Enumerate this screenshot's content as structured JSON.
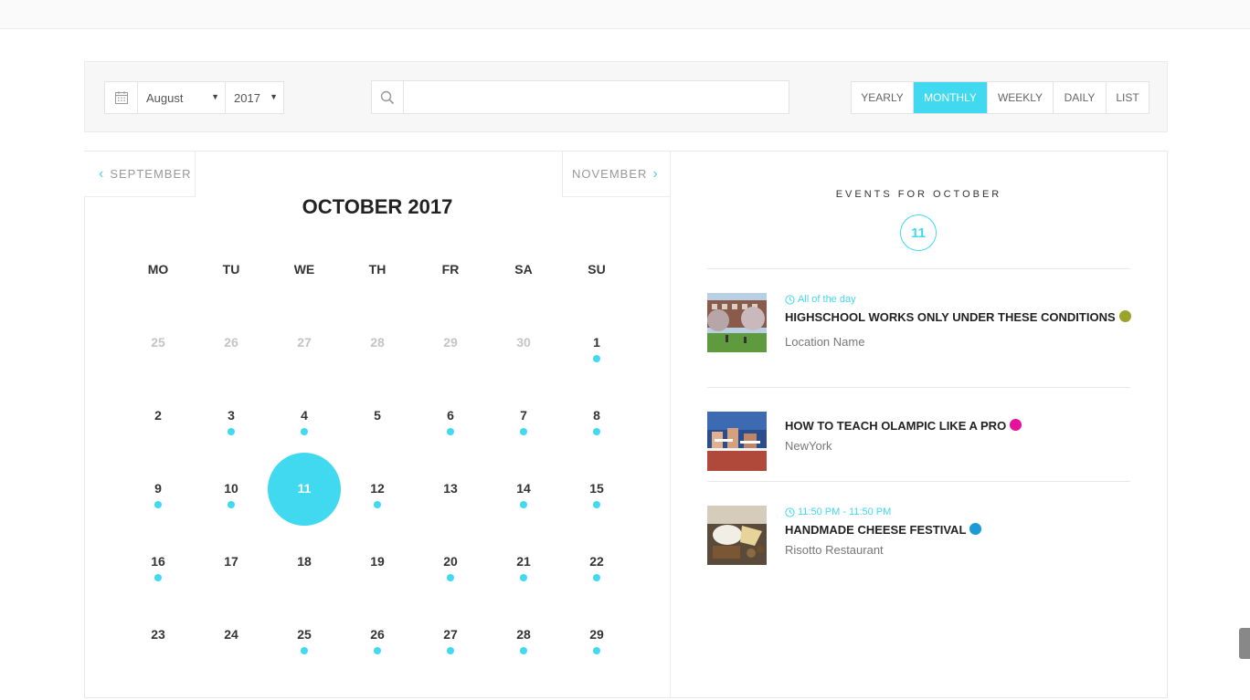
{
  "filter": {
    "month": "August",
    "year": "2017",
    "search_value": "",
    "views": [
      "YEARLY",
      "MONTHLY",
      "WEEKLY",
      "DAILY",
      "LIST"
    ],
    "active_view": "MONTHLY"
  },
  "calendar": {
    "prev_label": "SEPTEMBER",
    "next_label": "NOVEMBER",
    "title": "OCTOBER 2017",
    "weekdays": [
      "MO",
      "TU",
      "WE",
      "TH",
      "FR",
      "SA",
      "SU"
    ],
    "weeks": [
      [
        {
          "d": "25",
          "other": true
        },
        {
          "d": "26",
          "other": true
        },
        {
          "d": "27",
          "other": true
        },
        {
          "d": "28",
          "other": true
        },
        {
          "d": "29",
          "other": true
        },
        {
          "d": "30",
          "other": true
        },
        {
          "d": "1",
          "dot": true
        }
      ],
      [
        {
          "d": "2"
        },
        {
          "d": "3",
          "dot": true
        },
        {
          "d": "4",
          "dot": true
        },
        {
          "d": "5"
        },
        {
          "d": "6",
          "dot": true
        },
        {
          "d": "7",
          "dot": true
        },
        {
          "d": "8",
          "dot": true
        }
      ],
      [
        {
          "d": "9",
          "dot": true
        },
        {
          "d": "10",
          "dot": true
        },
        {
          "d": "11",
          "selected": true
        },
        {
          "d": "12",
          "dot": true
        },
        {
          "d": "13"
        },
        {
          "d": "14",
          "dot": true
        },
        {
          "d": "15",
          "dot": true
        }
      ],
      [
        {
          "d": "16",
          "dot": true
        },
        {
          "d": "17"
        },
        {
          "d": "18"
        },
        {
          "d": "19"
        },
        {
          "d": "20",
          "dot": true
        },
        {
          "d": "21",
          "dot": true
        },
        {
          "d": "22",
          "dot": true
        }
      ],
      [
        {
          "d": "23"
        },
        {
          "d": "24"
        },
        {
          "d": "25",
          "dot": true
        },
        {
          "d": "26",
          "dot": true
        },
        {
          "d": "27",
          "dot": true
        },
        {
          "d": "28",
          "dot": true
        },
        {
          "d": "29",
          "dot": true
        }
      ]
    ]
  },
  "events_panel": {
    "title": "EVENTS FOR OCTOBER",
    "selected_day": "11",
    "events": [
      {
        "time": "All of the day",
        "name": "HIGHSCHOOL WORKS ONLY UNDER THESE CONDITIONS",
        "color": "#9aa42b",
        "location": "Location Name",
        "thumb": "campus"
      },
      {
        "time": "",
        "name": "HOW TO TEACH OLAMPIC LIKE A PRO",
        "color": "#e8119b",
        "location": "NewYork",
        "thumb": "hurdles"
      },
      {
        "time": "11:50 PM - 11:50 PM",
        "name": "HANDMADE CHEESE FESTIVAL",
        "color": "#1a9ad6",
        "location": "Risotto Restaurant",
        "thumb": "cheese"
      }
    ]
  },
  "colors": {
    "accent": "#40d9ef"
  }
}
